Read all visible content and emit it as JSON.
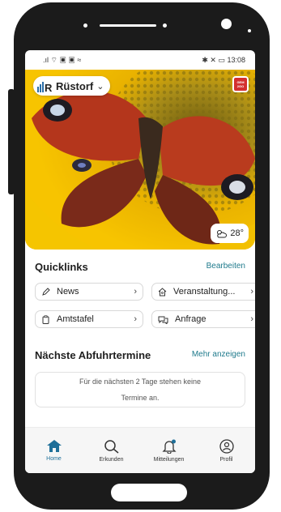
{
  "statusbar": {
    "left_icons": ".ıl ⌔ ▣ ▣ ≈",
    "right_icons": "✱ ✕ ▭",
    "time": "13:08"
  },
  "hero": {
    "location": "Rüstorf",
    "location_chevron": "⌄",
    "badge_text": "GEM 2GO",
    "weather_icon": "cloud-sun-icon",
    "temperature": "28°"
  },
  "quicklinks": {
    "title": "Quicklinks",
    "edit_label": "Bearbeiten",
    "items": [
      {
        "label": "News",
        "icon": "pencil-icon"
      },
      {
        "label": "Veranstaltung...",
        "icon": "house-icon"
      },
      {
        "label": "Amtstafel",
        "icon": "clipboard-icon"
      },
      {
        "label": "Anfrage",
        "icon": "chat-icon"
      }
    ]
  },
  "pickup": {
    "title": "Nächste Abfuhrtermine",
    "more_label": "Mehr anzeigen",
    "notice_line1": "Für die nächsten 2 Tage stehen keine",
    "notice_line2": "Termine an."
  },
  "tabbar": {
    "accent": "#1f6f99",
    "items": [
      {
        "label": "Home",
        "icon": "home-icon"
      },
      {
        "label": "Erkunden",
        "icon": "search-icon"
      },
      {
        "label": "Mitteilungen",
        "icon": "bell-icon"
      },
      {
        "label": "Profil",
        "icon": "profile-icon"
      }
    ]
  }
}
